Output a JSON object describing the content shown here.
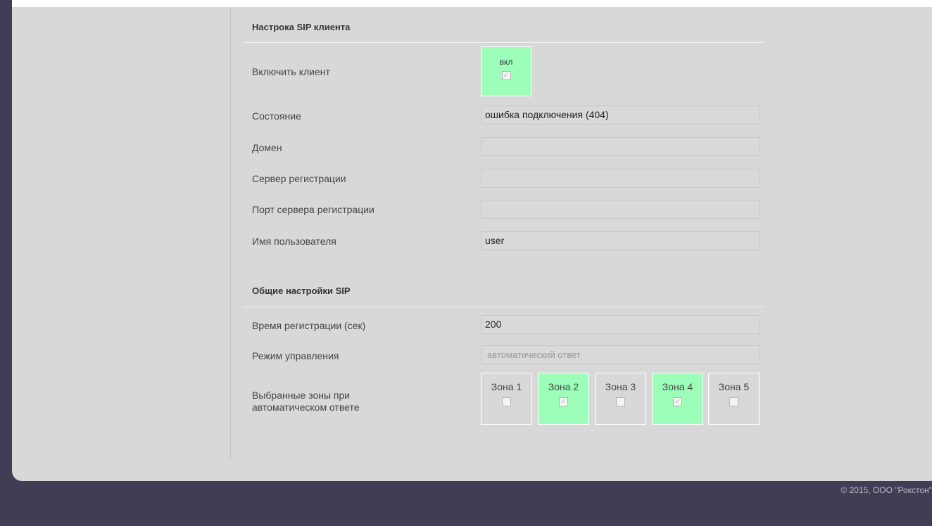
{
  "sip_client": {
    "title": "Настрока SIP клиента",
    "enable": {
      "label": "Включить клиент",
      "toggle_text": "вкл",
      "checked": true,
      "check_glyph": "✓"
    },
    "status": {
      "label": "Состояние",
      "value": "ошибка подключения (404)"
    },
    "domain": {
      "label": "Домен",
      "value": ""
    },
    "reg_server": {
      "label": "Сервер регистрации",
      "value": ""
    },
    "reg_port": {
      "label": "Порт сервера регистрации",
      "value": ""
    },
    "username": {
      "label": "Имя пользователя",
      "value": "user"
    }
  },
  "sip_general": {
    "title": "Общие настройки SIP",
    "reg_time": {
      "label": "Время регистрации (сек)",
      "value": "200"
    },
    "control_mode": {
      "label": "Режим управления",
      "value": "автоматический ответ"
    },
    "zones": {
      "label_line1": "Выбранные зоны при",
      "label_line2": "автоматическом ответе",
      "items": [
        {
          "label": "Зона 1",
          "checked": false,
          "check_glyph": ""
        },
        {
          "label": "Зона 2",
          "checked": true,
          "check_glyph": "✓"
        },
        {
          "label": "Зона 3",
          "checked": false,
          "check_glyph": ""
        },
        {
          "label": "Зона 4",
          "checked": true,
          "check_glyph": "✓"
        },
        {
          "label": "Зона 5",
          "checked": false,
          "check_glyph": ""
        }
      ]
    }
  },
  "footer": {
    "copyright": "© 2015, ООО \"Рокстон\""
  },
  "colors": {
    "panel_bg": "#d8d8d8",
    "frame_bg": "#403d55",
    "active_green": "#9cfeb9"
  }
}
